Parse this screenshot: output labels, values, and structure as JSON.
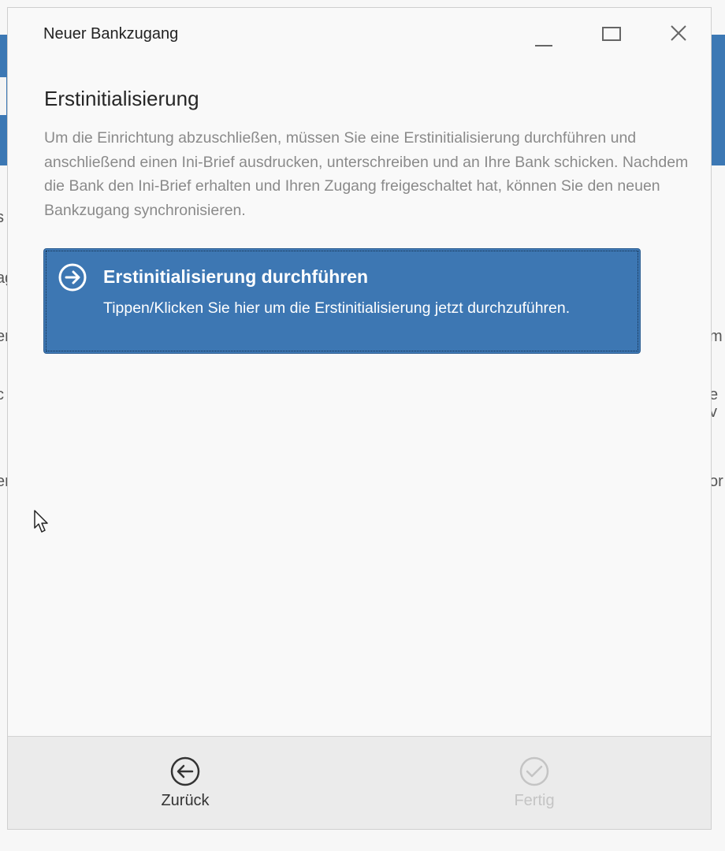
{
  "background": {
    "band_color": "#3c78b4",
    "left_fragments": [
      "s",
      "ag",
      "er",
      "c",
      "er"
    ],
    "right_fragments": [
      "m",
      "e v",
      "or"
    ]
  },
  "dialog": {
    "window_title": "Neuer Bankzugang",
    "window_controls": [
      "minimize-icon",
      "maximize-icon",
      "close-icon"
    ],
    "heading": "Erstinitialisierung",
    "description": "Um die Einrichtung abzuschließen, müssen Sie eine Erstinitialisierung durchführen und anschließend einen Ini-Brief ausdrucken, unterschreiben und an Ihre Bank schicken. Nachdem die Bank den Ini-Brief erhalten und Ihren Zugang freigeschaltet hat, können Sie den neuen Bankzugang synchronisieren.",
    "action": {
      "icon": "arrow-right-circle-icon",
      "title": "Erstinitialisierung durchführen",
      "subtitle": "Tippen/Klicken Sie hier um die Erstinitialisierung jetzt durchzuführen.",
      "color": "#3d77b3"
    },
    "footer": {
      "back": {
        "icon": "arrow-left-circle-icon",
        "label": "Zurück",
        "enabled": true
      },
      "done": {
        "icon": "checkmark-circle-icon",
        "label": "Fertig",
        "enabled": false
      }
    }
  }
}
